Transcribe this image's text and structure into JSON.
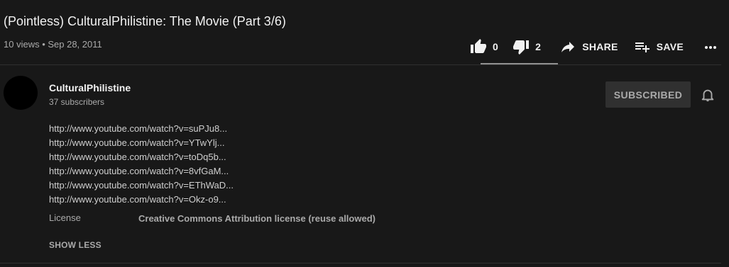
{
  "video": {
    "title": "(Pointless) CulturalPhilistine: The Movie (Part 3/6)",
    "meta": "10 views • Sep 28, 2011"
  },
  "actions": {
    "like_count": "0",
    "dislike_count": "2",
    "share_label": "SHARE",
    "save_label": "SAVE"
  },
  "channel": {
    "name": "CulturalPhilistine",
    "subscribers": "37 subscribers",
    "subscribe_button": "SUBSCRIBED"
  },
  "description": {
    "links": [
      "http://www.youtube.com/watch?v=suPJu8...",
      "http://www.youtube.com/watch?v=YTwYlj...",
      "http://www.youtube.com/watch?v=toDq5b...",
      "http://www.youtube.com/watch?v=8vfGaM...",
      "http://www.youtube.com/watch?v=EThWaD...",
      "http://www.youtube.com/watch?v=Okz-o9..."
    ],
    "license_label": "License",
    "license_value": "Creative Commons Attribution license (reuse allowed)",
    "show_less": "SHOW LESS"
  },
  "colors": {
    "background": "#181818",
    "text_primary": "#f1f1f1",
    "text_secondary": "#aaaaaa",
    "button_bg": "#303030",
    "divider": "#303030"
  }
}
